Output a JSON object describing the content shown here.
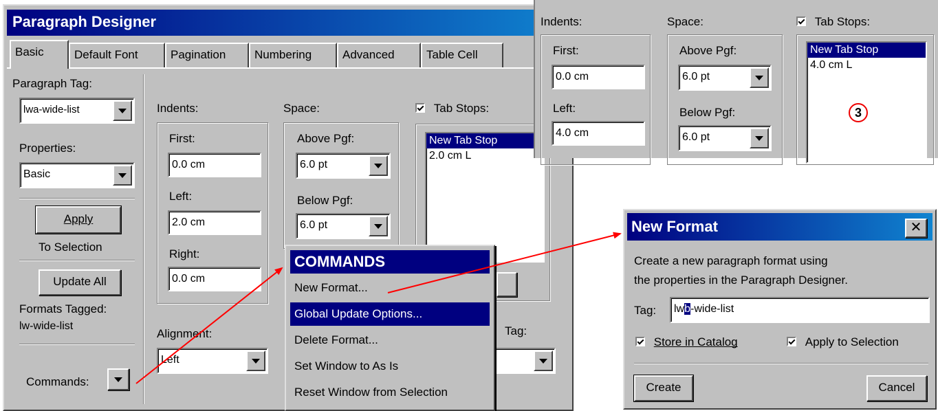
{
  "designer": {
    "title": "Paragraph Designer",
    "tabs": [
      "Basic",
      "Default Font",
      "Pagination",
      "Numbering",
      "Advanced",
      "Table Cell"
    ],
    "paragraph_tag_label": "Paragraph Tag:",
    "paragraph_tag_value": "lwa-wide-list",
    "properties_label": "Properties:",
    "properties_value": "Basic",
    "apply_label": "Apply",
    "apply_sub": "To Selection",
    "update_all_label": "Update All",
    "formats_tagged_label": "Formats Tagged:",
    "formats_tagged_value": "lw-wide-list",
    "commands_label": "Commands:",
    "indents_label": "Indents:",
    "first_label": "First:",
    "first_value": "0.0 cm",
    "left_label": "Left:",
    "left_value": "2.0 cm",
    "right_label": "Right:",
    "right_value": "0.0 cm",
    "space_label": "Space:",
    "above_label": "Above Pgf:",
    "above_value": "6.0 pt",
    "below_label": "Below Pgf:",
    "below_value": "6.0 pt",
    "tab_stops_label": "Tab Stops:",
    "tab_stops": [
      "New Tab Stop",
      "2.0 cm  L"
    ],
    "alignment_label": "Alignment:",
    "alignment_value": "Left",
    "tag_label": "Tag:"
  },
  "commands_menu": {
    "title": "COMMANDS",
    "items": [
      "New Format...",
      "Global Update Options...",
      "Delete Format...",
      "Set Window to As Is",
      "Reset Window from Selection"
    ],
    "selected_index": 1
  },
  "zoom_inset": {
    "indents_label": "Indents:",
    "first_label": "First:",
    "first_value": "0.0 cm",
    "left_label": "Left:",
    "left_value": "4.0 cm",
    "space_label": "Space:",
    "above_label": "Above Pgf:",
    "above_value": "6.0 pt",
    "below_label": "Below Pgf:",
    "below_value": "6.0 pt",
    "tab_stops_label": "Tab Stops:",
    "tab_stops": [
      "New Tab Stop",
      "4.0 cm  L"
    ],
    "callout_number": "3"
  },
  "new_format_dialog": {
    "title": "New Format",
    "description_line1": "Create a new paragraph format using",
    "description_line2": "the properties in the Paragraph Designer.",
    "tag_label": "Tag:",
    "tag_value_before": "lw",
    "tag_value_selected": "b",
    "tag_value_after": "-wide-list",
    "store_in_catalog_label": "Store in Catalog",
    "apply_to_selection_label": "Apply to Selection",
    "create_label": "Create",
    "cancel_label": "Cancel"
  },
  "colors": {
    "title_bar": "#000080",
    "window_face": "#c0c0c0",
    "selection": "#000080",
    "arrow": "#ff0000"
  }
}
